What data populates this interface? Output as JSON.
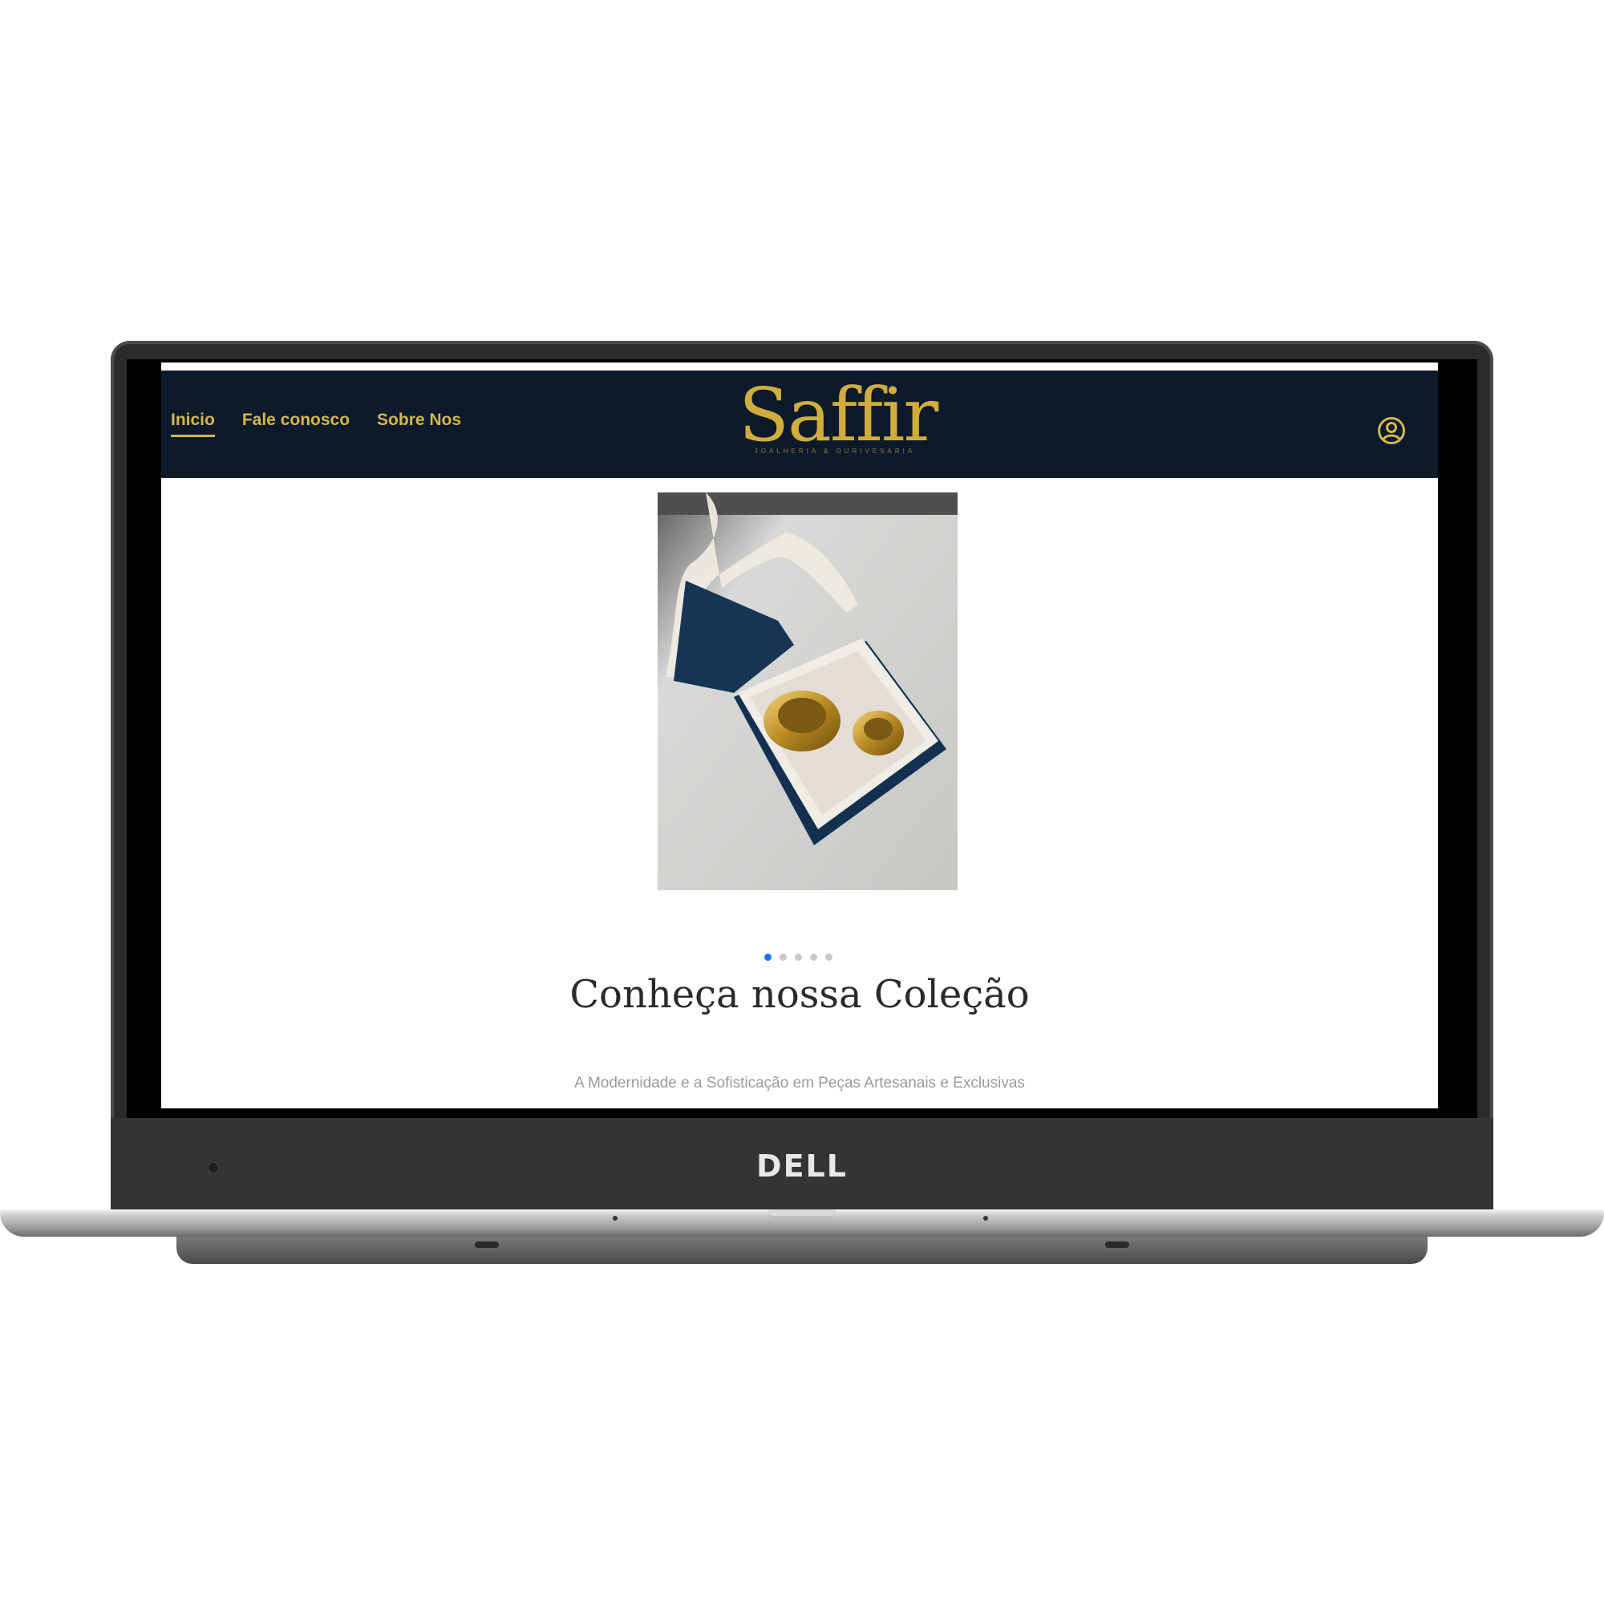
{
  "device": {
    "brand": "DELL"
  },
  "navbar": {
    "links": [
      {
        "label": "Inicio",
        "active": true
      },
      {
        "label": "Fale conosco"
      },
      {
        "label": "Sobre Nos"
      }
    ],
    "logo": {
      "name": "Saffir",
      "tagline": "JOALHERIA & OURIVESARIA"
    },
    "user_icon": "user-circle-icon"
  },
  "hero": {
    "image_alt": "Alianças douradas em caixa azul com laço",
    "carousel": {
      "total": 5,
      "active": 1
    }
  },
  "content": {
    "title": "Conheça nossa Coleção",
    "subtitle": "A Modernidade e a Sofisticação em Peças Artesanais e Exclusivas"
  },
  "colors": {
    "navbar_bg": "#0c1a2b",
    "gold": "#d7b64a",
    "carousel_active": "#1a73e8"
  }
}
